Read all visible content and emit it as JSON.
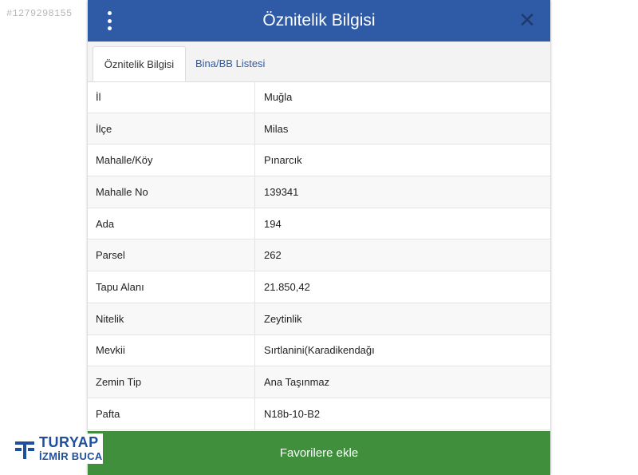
{
  "watermark": "#1279298155",
  "header": {
    "title": "Öznitelik Bilgisi",
    "menu_icon": "kebab-menu-icon",
    "close_icon": "close-icon",
    "close_glyph": "✕"
  },
  "tabs": [
    {
      "label": "Öznitelik Bilgisi",
      "active": true
    },
    {
      "label": "Bina/BB Listesi",
      "active": false
    }
  ],
  "rows": [
    {
      "key": "İl",
      "value": "Muğla"
    },
    {
      "key": "İlçe",
      "value": "Milas"
    },
    {
      "key": "Mahalle/Köy",
      "value": "Pınarcık"
    },
    {
      "key": "Mahalle No",
      "value": "139341"
    },
    {
      "key": "Ada",
      "value": "194"
    },
    {
      "key": "Parsel",
      "value": "262"
    },
    {
      "key": "Tapu Alanı",
      "value": "21.850,42"
    },
    {
      "key": "Nitelik",
      "value": "Zeytinlik"
    },
    {
      "key": "Mevkii",
      "value": "Sırtlanini(Karadikendağı"
    },
    {
      "key": "Zemin Tip",
      "value": "Ana Taşınmaz"
    },
    {
      "key": "Pafta",
      "value": "N18b-10-B2"
    }
  ],
  "favorite_button": "Favorilere ekle",
  "logo": {
    "line1": "TURYAP",
    "line2": "İZMİR BUCA",
    "color": "#1f4f9c"
  },
  "colors": {
    "header": "#2f5ba6",
    "button": "#3f8f3c"
  }
}
